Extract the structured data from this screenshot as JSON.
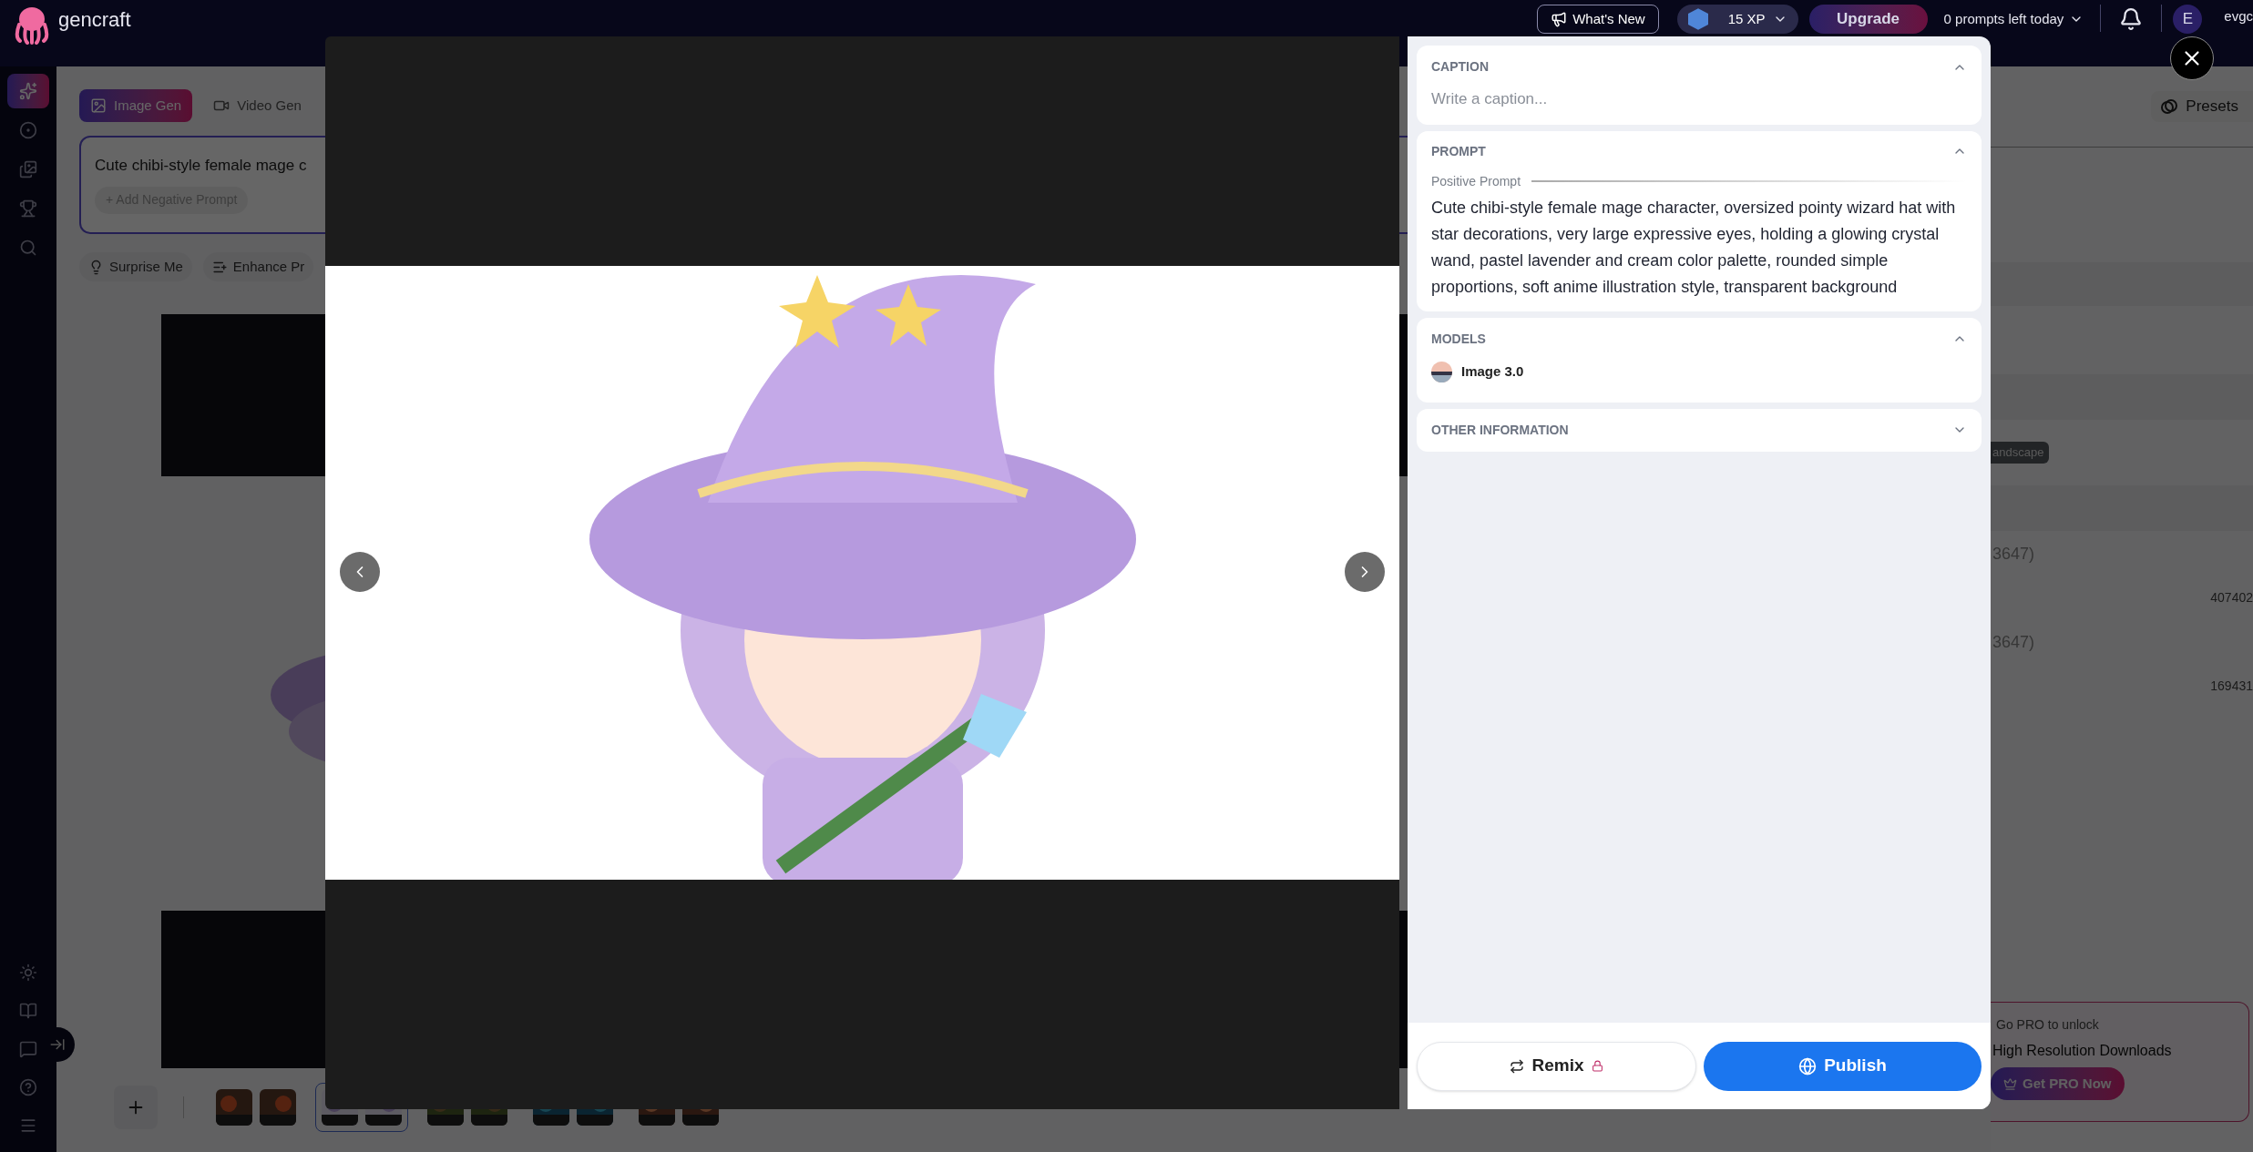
{
  "top_bar": {
    "logo": "gencraft",
    "whats_new": "What's New",
    "xp": "15 XP",
    "upgrade": "Upgrade",
    "prompts_left": "0 prompts left today",
    "avatar_initial": "E",
    "username": "evgc"
  },
  "sidebar": {
    "items": [
      {
        "selected": true
      },
      {
        "selected": false
      },
      {
        "selected": false
      },
      {
        "selected": false
      },
      {
        "selected": false
      }
    ]
  },
  "generator": {
    "tabs": [
      {
        "label": "Image Gen",
        "selected": true
      },
      {
        "label": "Video Gen",
        "selected": false
      }
    ],
    "prompt": "Cute chibi-style female mage c",
    "negative_prompt_button": "+ Add Negative Prompt",
    "actions": [
      "Surprise Me",
      "Enhance Pr"
    ],
    "thumbnail_groups": [
      {
        "selected": false
      },
      {
        "selected": true
      },
      {
        "selected": false
      },
      {
        "selected": false
      },
      {
        "selected": false
      }
    ]
  },
  "settings_panel": {
    "presets": "Presets",
    "tag": "andscape",
    "rows": [
      {
        "column_1": "3647)",
        "column_2": "407402"
      },
      {
        "column_1": "3647)",
        "column_2": "169431"
      }
    ],
    "promo": {
      "text": "Go PRO to unlock",
      "feature": "High Resolution Downloads",
      "button": "Get PRO Now"
    }
  },
  "modal": {
    "sections": [
      {
        "kind": "caption",
        "title": "CAPTION",
        "expanded": true,
        "placeholder": "Write a caption..."
      },
      {
        "kind": "prompt",
        "title": "PROMPT",
        "expanded": true,
        "subtitle": "Positive Prompt",
        "text": "Cute chibi-style female mage character, oversized pointy wizard hat with star decorations, very large expressive eyes, holding a glowing crystal wand, pastel lavender and cream color palette, rounded simple proportions, soft anime illustration style, transparent background"
      },
      {
        "kind": "models",
        "title": "MODELS",
        "expanded": true,
        "models": [
          {
            "name": "Image 3.0"
          }
        ]
      },
      {
        "kind": "info",
        "title": "OTHER INFORMATION",
        "expanded": false
      }
    ],
    "remix": {
      "label": "Remix",
      "locked": true
    },
    "publish": {
      "label": "Publish"
    }
  }
}
